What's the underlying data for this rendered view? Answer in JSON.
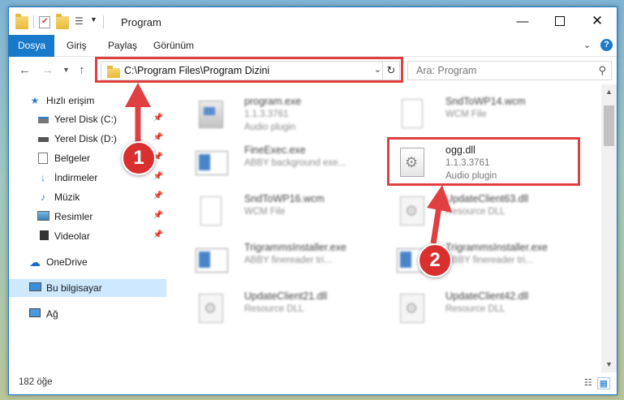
{
  "window": {
    "title": "Program"
  },
  "ribbon": {
    "tabs": [
      "Dosya",
      "Giriş",
      "Paylaş",
      "Görünüm"
    ]
  },
  "address": {
    "path": "C:\\Program Files\\Program Dizini"
  },
  "search": {
    "placeholder": "Ara: Program"
  },
  "sidebar": {
    "items": [
      {
        "label": "Hızlı erişim",
        "icon": "star-icon"
      },
      {
        "label": "Yerel Disk (C:)",
        "icon": "drive-icon"
      },
      {
        "label": "Yerel Disk (D:)",
        "icon": "drive-icon"
      },
      {
        "label": "Belgeler",
        "icon": "documents-icon"
      },
      {
        "label": "İndirmeler",
        "icon": "download-icon"
      },
      {
        "label": "Müzik",
        "icon": "music-icon"
      },
      {
        "label": "Resimler",
        "icon": "pictures-icon"
      },
      {
        "label": "Videolar",
        "icon": "videos-icon"
      },
      {
        "label": "OneDrive",
        "icon": "cloud-icon"
      },
      {
        "label": "Bu bilgisayar",
        "icon": "computer-icon"
      },
      {
        "label": "Ağ",
        "icon": "network-icon"
      }
    ]
  },
  "files": [
    {
      "name": "program.exe",
      "line2": "1.1.3.3761",
      "line3": "Audio plugin"
    },
    {
      "name": "SndToWP14.wcm",
      "line2": "WCM File",
      "line3": ""
    },
    {
      "name": "FineExec.exe",
      "line2": "ABBY background exe...",
      "line3": ""
    },
    {
      "name": "ogg.dll",
      "line2": "1.1.3.3761",
      "line3": "Audio plugin"
    },
    {
      "name": "SndToWP16.wcm",
      "line2": "WCM File",
      "line3": ""
    },
    {
      "name": "UpdateClient63.dll",
      "line2": "Resource DLL",
      "line3": ""
    },
    {
      "name": "TrigrammsInstaller.exe",
      "line2": "ABBY finereader tri...",
      "line3": ""
    },
    {
      "name": "TrigrammsInstaller.exe",
      "line2": "ABBY finereader tri...",
      "line3": ""
    },
    {
      "name": "UpdateClient21.dll",
      "line2": "Resource DLL",
      "line3": ""
    },
    {
      "name": "UpdateClient42.dll",
      "line2": "Resource DLL",
      "line3": ""
    }
  ],
  "status": {
    "count": "182 öğe"
  },
  "annotations": {
    "step1": "1",
    "step2": "2",
    "color": "#e04040"
  }
}
